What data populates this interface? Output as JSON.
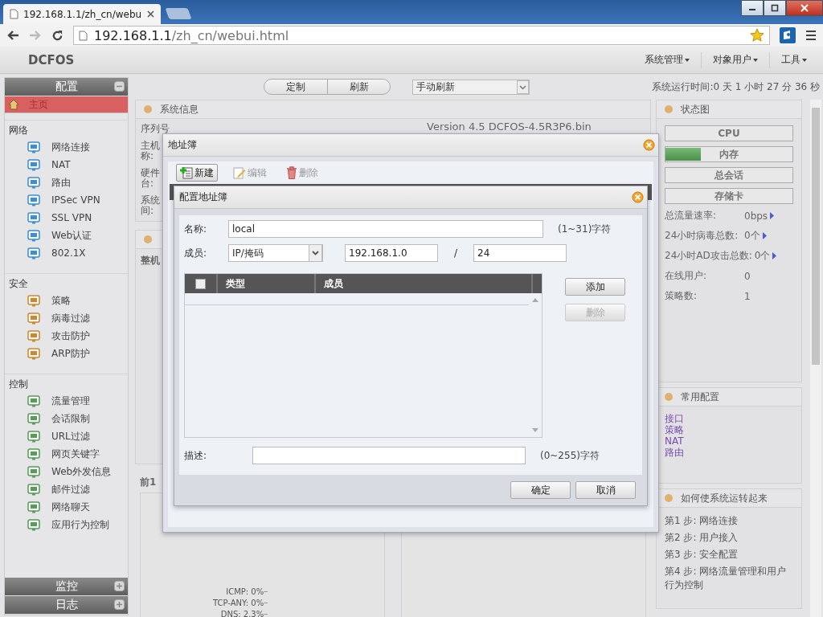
{
  "browser": {
    "tab_title": "192.168.1.1/zh_cn/webu",
    "url_host": "192.168.1.1",
    "url_path": "/zh_cn/webui.html",
    "forward_enabled": false,
    "bookmarked": true
  },
  "app": {
    "logo": "DCFOS",
    "menus": [
      {
        "label": "系统管理"
      },
      {
        "label": "对象用户"
      },
      {
        "label": "工具"
      }
    ]
  },
  "top_bar": {
    "buttons": [
      {
        "label": "定制"
      },
      {
        "label": "刷新"
      }
    ],
    "refresh_mode": "手动刷新",
    "uptime": "系统运行时间:0 天 1 小时 27 分 36 秒"
  },
  "sidebar": {
    "panels": [
      {
        "title": "配置",
        "expanded": true,
        "home": {
          "label": "主页",
          "selected": true
        },
        "groups": [
          {
            "title": "网络",
            "items": [
              {
                "label": "网络连接",
                "selected": false
              },
              {
                "label": "NAT",
                "selected": false
              },
              {
                "label": "路由",
                "selected": false
              },
              {
                "label": "IPSec VPN",
                "selected": false
              },
              {
                "label": "SSL VPN",
                "selected": false
              },
              {
                "label": "Web认证",
                "selected": false
              },
              {
                "label": "802.1X",
                "selected": false
              }
            ]
          },
          {
            "title": "安全",
            "items": [
              {
                "label": "策略",
                "selected": false
              },
              {
                "label": "病毒过滤",
                "selected": false
              },
              {
                "label": "攻击防护",
                "selected": false
              },
              {
                "label": "ARP防护",
                "selected": false
              }
            ]
          },
          {
            "title": "控制",
            "items": [
              {
                "label": "流量管理",
                "selected": false
              },
              {
                "label": "会话限制",
                "selected": false
              },
              {
                "label": "URL过滤",
                "selected": false
              },
              {
                "label": "网页关键字",
                "selected": false
              },
              {
                "label": "Web外发信息",
                "selected": false
              },
              {
                "label": "邮件过滤",
                "selected": false
              },
              {
                "label": "网络聊天",
                "selected": false
              },
              {
                "label": "应用行为控制",
                "selected": false
              }
            ]
          }
        ]
      },
      {
        "title": "监控",
        "expanded": false
      },
      {
        "title": "日志",
        "expanded": false
      }
    ]
  },
  "system_info": {
    "title": "系统信息",
    "labels": [
      "序列号",
      "主机称:",
      "硬件台:",
      "系统间:"
    ],
    "version": "Version 4.5 DCFOS-4.5R3P6.bin"
  },
  "overview_panel": {
    "subtitle": "整机"
  },
  "top_panel": {
    "subtitle": "前1",
    "chart_labels": [
      "ICMP: 0%",
      "TCP-ANY: 0%",
      "DNS: 2.3%"
    ]
  },
  "status_panel": {
    "title": "状态图",
    "bars": [
      {
        "label": "CPU",
        "level": 0
      },
      {
        "label": "内存",
        "level": 0.28
      },
      {
        "label": "总会话",
        "level": 0
      },
      {
        "label": "存储卡",
        "level": 0
      }
    ],
    "stats": [
      {
        "label": "总流量速率:",
        "value": "0bps",
        "kind": "link"
      },
      {
        "label": "24小时病毒总数:",
        "value": "0个",
        "kind": "link"
      },
      {
        "label": "24小时AD攻击总数:",
        "value": "0个",
        "kind": "link"
      },
      {
        "label": "在线用户:",
        "value": "0",
        "kind": "plain"
      },
      {
        "label": "策略数:",
        "value": "1",
        "kind": "plain"
      }
    ]
  },
  "common_config": {
    "title": "常用配置",
    "links": [
      "接口",
      "策略",
      "NAT",
      "路由"
    ]
  },
  "getting_started": {
    "title": "如何使系统运转起来",
    "steps": [
      "第1 步: 网络连接",
      "第2 步: 用户接入",
      "第3 步: 安全配置",
      "第4 步: 网络流量管理和用户行为控制"
    ]
  },
  "address_book": {
    "title": "地址簿",
    "toolbar": [
      {
        "label": "新建",
        "kind": "new",
        "disabled": false,
        "pressed": true
      },
      {
        "label": "编辑",
        "kind": "edit",
        "disabled": true,
        "pressed": false
      },
      {
        "label": "删除",
        "kind": "delete",
        "disabled": true,
        "pressed": false
      }
    ]
  },
  "config_dialog": {
    "title": "配置地址簿",
    "name_label": "名称:",
    "name_value": "local",
    "name_hint": "(1~31)字符",
    "member_label": "成员:",
    "member_type": "IP/掩码",
    "ip": "192.168.1.0",
    "slash": "/",
    "mask": "24",
    "table": {
      "columns": [
        "类型",
        "成员"
      ],
      "all_checked": false
    },
    "add_button": {
      "label": "添加",
      "disabled": false
    },
    "remove_button": {
      "label": "删除",
      "disabled": true
    },
    "desc_label": "描述:",
    "desc_hint": "(0~255)字符",
    "ok": "确定",
    "cancel": "取消"
  }
}
